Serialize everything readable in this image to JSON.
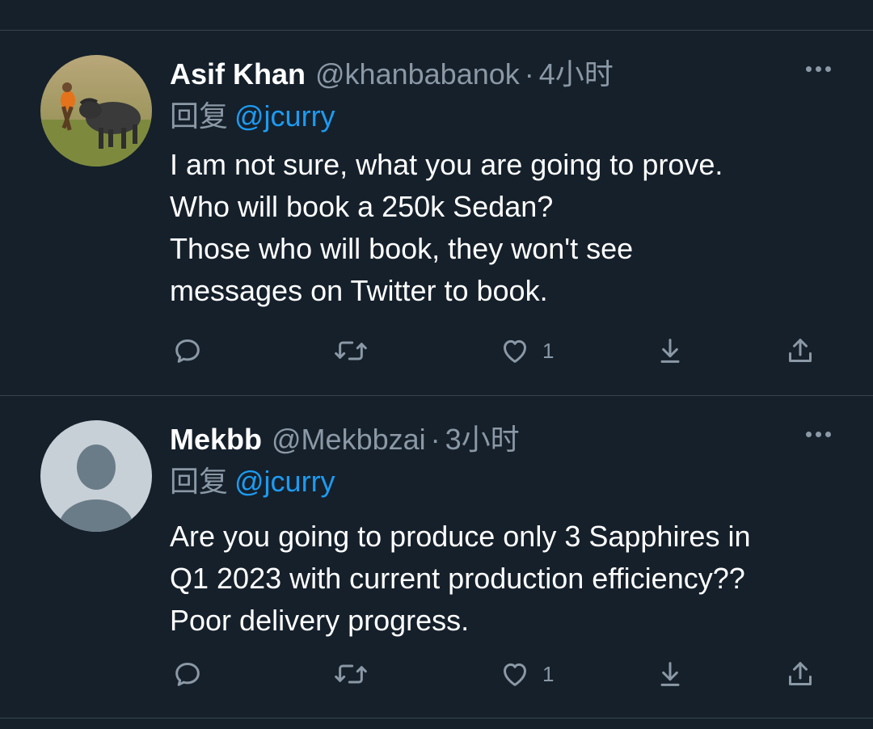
{
  "tweets": [
    {
      "name": "Asif Khan",
      "handle": "@khanbabanok",
      "separator": "·",
      "time": "4小时",
      "reply_prefix": "回复",
      "reply_to": "@jcurry",
      "text_lines": [
        "I am not sure, what you are going to prove.",
        "Who will book a 250k Sedan?",
        "Those who will book, they won't see",
        "messages on Twitter to book."
      ],
      "like_count": "1"
    },
    {
      "name": "Mekbb",
      "handle": "@Mekbbzai",
      "separator": "·",
      "time": "3小时",
      "reply_prefix": "回复",
      "reply_to": "@jcurry",
      "text_lines": [
        "Are you going to produce only 3 Sapphires in",
        "Q1 2023 with current production efficiency??",
        "Poor delivery progress."
      ],
      "like_count": "1"
    }
  ],
  "icons": [
    "reply-icon",
    "retweet-icon",
    "like-icon",
    "bookmark-icon",
    "share-icon",
    "more-icon"
  ],
  "colors": {
    "background": "#15202b",
    "accent": "#1d9bf0",
    "muted": "#8b98a5",
    "divider": "#38444d"
  }
}
